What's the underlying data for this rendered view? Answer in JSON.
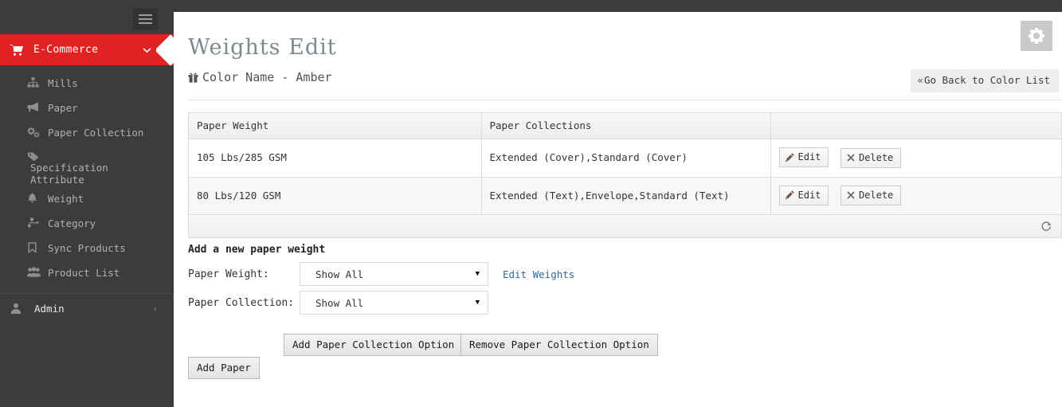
{
  "sidebar": {
    "brand": {
      "label": "E-Commerce",
      "icon": "shopping-cart-icon",
      "chevron": "⌄",
      "bg": "#e02222"
    },
    "items": [
      {
        "label": "Mills",
        "icon": "sitemap-icon"
      },
      {
        "label": "Paper",
        "icon": "bullhorn-icon"
      },
      {
        "label": "Paper Collection",
        "icon": "cogs-icon"
      },
      {
        "label": "Specification Attribute",
        "icon": "tag-icon"
      },
      {
        "label": "Weight",
        "icon": "bell-icon"
      },
      {
        "label": "Category",
        "icon": "sitemap-alt-icon"
      },
      {
        "label": "Sync Products",
        "icon": "bookmark-icon"
      },
      {
        "label": "Product List",
        "icon": "users-icon"
      }
    ],
    "admin": {
      "label": "Admin",
      "icon": "user-icon",
      "chevron": "‹"
    },
    "hamburger": "hamburger-icon"
  },
  "header": {
    "title": "Weights Edit",
    "subtitle": "Color Name - Amber",
    "subtitle_icon": "gift-icon",
    "gear_icon": "gear-icon",
    "go_back_label": "Go Back to Color List",
    "go_back_chevron": "«"
  },
  "table": {
    "columns": [
      "Paper Weight",
      "Paper Collections",
      ""
    ],
    "rows": [
      {
        "weight": "105 Lbs/285 GSM",
        "collections": "Extended (Cover),Standard (Cover)",
        "edit_label": "Edit",
        "delete_label": "Delete"
      },
      {
        "weight": "80 Lbs/120 GSM",
        "collections": "Extended (Text),Envelope,Standard (Text)",
        "edit_label": "Edit",
        "delete_label": "Delete"
      }
    ],
    "footer_icon": "refresh-icon"
  },
  "form": {
    "title": "Add a new paper weight",
    "paper_weight": {
      "label": "Paper Weight:",
      "value": "Show All",
      "caret": "▼"
    },
    "paper_collection": {
      "label": "Paper Collection:",
      "value": "Show All",
      "caret": "▼"
    },
    "edit_weights_link": "Edit Weights",
    "add_collection_option": "Add Paper Collection Option",
    "remove_collection_option": "Remove Paper Collection Option",
    "add_paper": "Add Paper"
  }
}
